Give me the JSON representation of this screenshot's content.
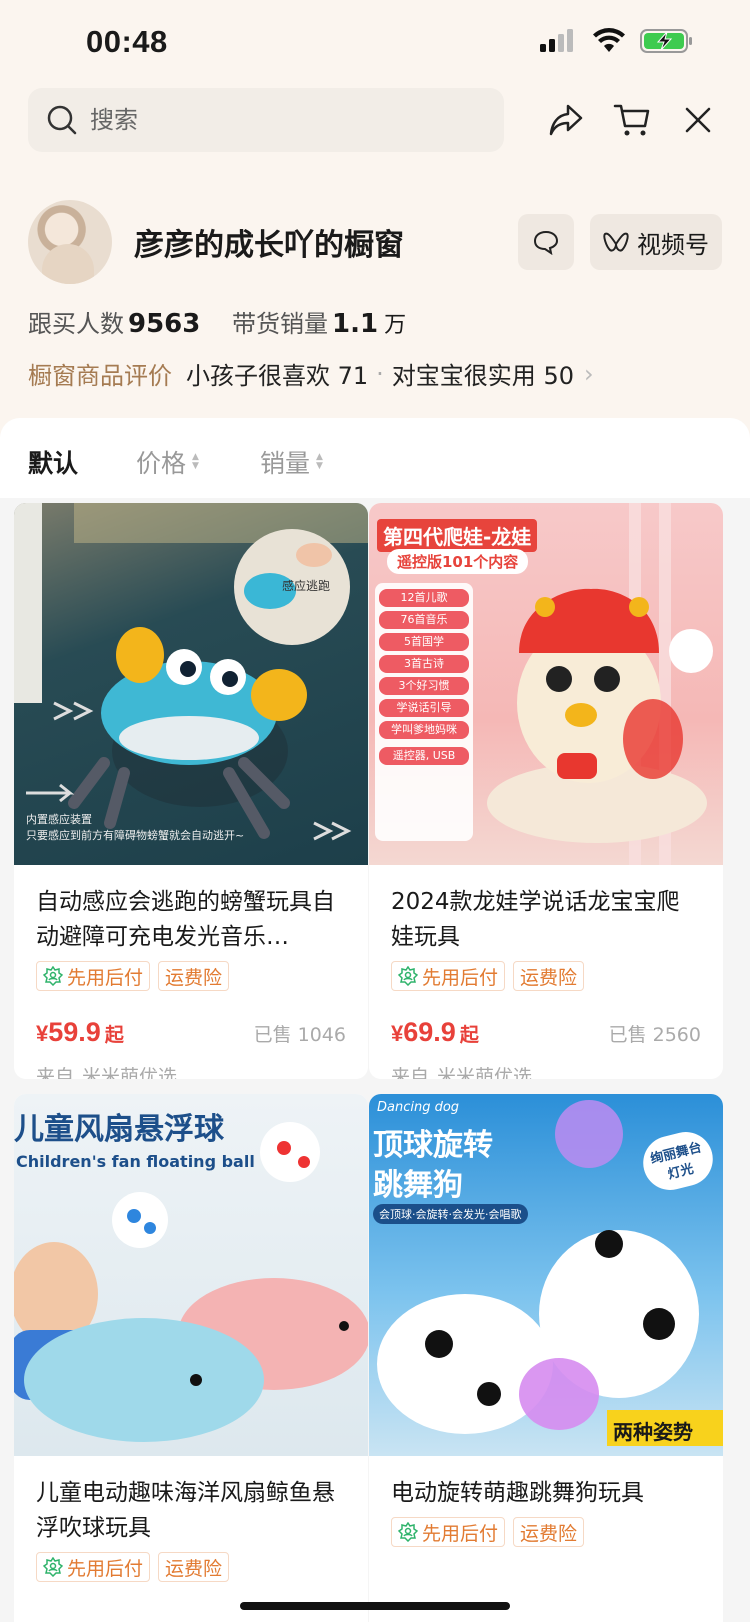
{
  "status": {
    "time": "00:48"
  },
  "search": {
    "placeholder": "搜索"
  },
  "profile": {
    "shop_name": "彦彦的成长吖的橱窗",
    "channel_label": "视频号"
  },
  "stats": {
    "followers_label": "跟买人数",
    "followers_value": "9563",
    "sales_label": "带货销量",
    "sales_value": "1.1",
    "sales_unit": "万"
  },
  "reviews": {
    "label": "橱窗商品评价",
    "items": [
      {
        "text": "小孩子很喜欢 71"
      },
      {
        "text": "对宝宝很实用 50"
      }
    ]
  },
  "sort": {
    "default": "默认",
    "price": "价格",
    "sales": "销量"
  },
  "products": [
    {
      "title": "自动感应会逃跑的螃蟹玩具自动避障可充电发光音乐…",
      "tag1": "先用后付",
      "tag2": "运费险",
      "price_symbol": "¥",
      "price": "59.9",
      "price_suffix": "起",
      "sold": "已售 1046",
      "from_label": "来自",
      "shop": "米米萌优选",
      "img_text_1": "感应逃跑",
      "img_text_2": "内置感应装置",
      "img_text_3": "只要感应到前方有障碍物螃蟹就会自动逃开~"
    },
    {
      "title": "2024款龙娃学说话龙宝宝爬娃玩具",
      "tag1": "先用后付",
      "tag2": "运费险",
      "price_symbol": "¥",
      "price": "69.9",
      "price_suffix": "起",
      "sold": "已售 2560",
      "from_label": "来自",
      "shop": "米米萌优选",
      "img_text_1": "第四代爬娃-龙娃",
      "img_text_2": "遥控版101个内容",
      "img_list": [
        "12首儿歌",
        "76首音乐",
        "5首国学",
        "3首古诗",
        "3个好习惯",
        "学说话引导",
        "学叫爹地妈咪",
        "遥控器, USB"
      ]
    },
    {
      "title": "儿童电动趣味海洋风扇鲸鱼悬浮吹球玩具",
      "tag1": "先用后付",
      "tag2": "运费险",
      "img_text_1": "儿童风扇悬浮球",
      "img_text_2": "Children's fan floating ball"
    },
    {
      "title": "电动旋转萌趣跳舞狗玩具",
      "tag1": "先用后付",
      "tag2": "运费险",
      "img_text_1": "Dancing dog",
      "img_text_2": "顶球旋转",
      "img_text_3": "跳舞狗",
      "img_text_4": "会顶球·会旋转·会发光·会唱歌",
      "img_text_5": "两种姿势",
      "img_text_6": "绚丽舞台灯光"
    }
  ],
  "colors": {
    "page_bg": "#fbf5ef",
    "price": "#e8413a",
    "tag": "#e27b32",
    "review_label": "#a57b52"
  }
}
